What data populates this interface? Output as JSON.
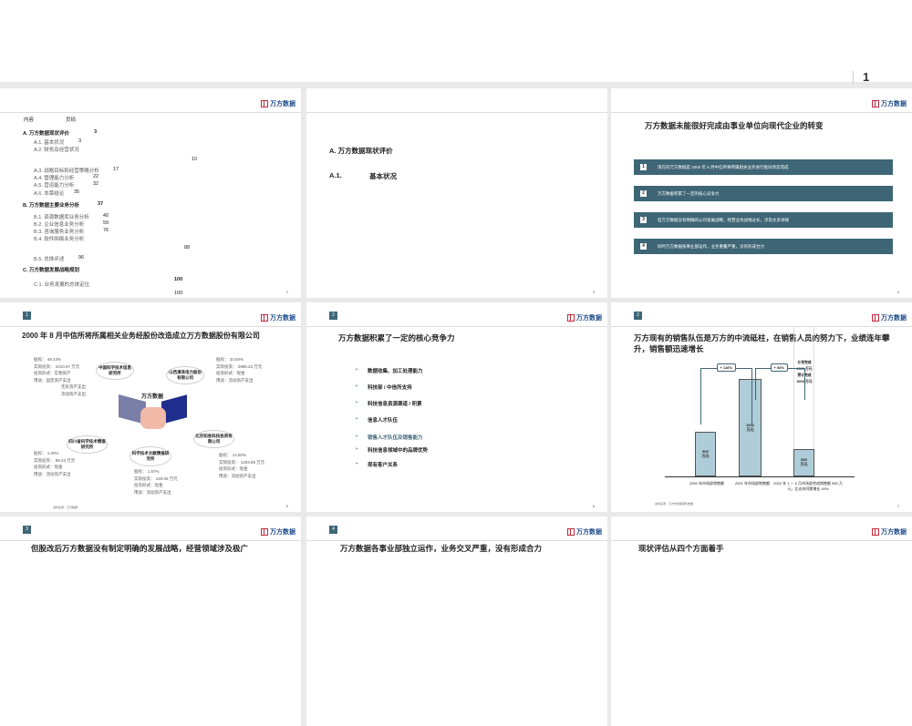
{
  "top_page": {
    "page_number": "1"
  },
  "brand": {
    "logo_text": "万方数据",
    "color": "#c0283a",
    "bar_color": "#3e6676"
  },
  "slides": [
    {
      "page": "2",
      "toc": {
        "header_content": "内容",
        "header_page": "页码",
        "items": [
          {
            "label": "A.  万方数据现状评价",
            "page": "3",
            "level": 1
          },
          {
            "label": "A.1.  基本状况",
            "page": "3",
            "level": 2
          },
          {
            "label": "A.2.  财务及经营状况",
            "page": "10",
            "level": 2
          },
          {
            "label": "A.3.  战略目标和经营策略分析",
            "page": "17",
            "level": 2
          },
          {
            "label": "A.4.  管理能力分析",
            "page": "22",
            "level": 2
          },
          {
            "label": "A.5.  营运能力分析",
            "page": "32",
            "level": 2
          },
          {
            "label": "A.6.  本章结论",
            "page": "35",
            "level": 2
          },
          {
            "label": "B.  万方数据主要业务分析",
            "page": "37",
            "level": 1
          },
          {
            "label": "B.1.  资源数据库业务分析",
            "page": "40",
            "level": 2
          },
          {
            "label": "B.2.  企业信息业务分析",
            "page": "59",
            "level": 2
          },
          {
            "label": "B.3.  咨询服务业务分析",
            "page": "76",
            "level": 2
          },
          {
            "label": "B.4.  软件网络业务分析",
            "page": "88",
            "level": 2
          },
          {
            "label": "B.5.  总体评述",
            "page": "96",
            "level": 2
          },
          {
            "label": "C.  万方数据发展战略规划",
            "page": "100",
            "level": 1
          },
          {
            "label": "C.1.  业务发展的总体定位",
            "page": "100",
            "level": 2
          }
        ]
      }
    },
    {
      "page": "3",
      "section": "A.  万方数据现状评价",
      "subsection_num": "A.1.",
      "subsection": "基本状况"
    },
    {
      "page": "4",
      "title": "万方数据未能很好完成由事业单位向现代企业的转变",
      "bars": [
        {
          "n": "1",
          "text": "现在的万方数据是  2000  年  8  月中信所将所属相关业务进行股份改造而成"
        },
        {
          "n": "2",
          "text": "万方数据积累了一定的核心竞争力"
        },
        {
          "n": "3",
          "text": "但万方数据没有明确的公司发展战略，经营业务战线过长，涉及太多领域"
        },
        {
          "n": "4",
          "text": "同时万方数据按事业部运作，业务重叠严重，没有形成合力"
        }
      ]
    },
    {
      "page": "5",
      "badge": "1",
      "title": "2000  年  8  月中信所将所属相关业务经股份改造成立万方数据股份有限公司",
      "center": "万方数据",
      "source": "资料来源：万方数据",
      "shareholders": [
        {
          "name": "中国科学技术信息研究所",
          "lines": [
            "股权：  49.43%",
            "实际投资：  4410.97  万元",
            "投资形式：实物资产",
            "用途：固定资产支出",
            "无形资产支出",
            "流动资产支出"
          ]
        },
        {
          "name": "山西漳泽电力股份有限公司",
          "lines": [
            "股权：  33.50%",
            "实际投资：  2989.23  万元",
            "投资形式：现金",
            "用途：流动资产支出"
          ]
        },
        {
          "name": "四川省科学技术情报研究所",
          "lines": [
            "股权：  1.00%",
            "实际投资：  89.23  万元",
            "投资形式：现金",
            "用途：流动资产支出"
          ]
        },
        {
          "name": "科学技术文献情报研究所",
          "lines": [
            "股权：  1.57%",
            "实际投资：  140.09  万元",
            "投资形式：现金",
            "用途：流动资产支出"
          ]
        },
        {
          "name": "北京知金科技投资有限公司",
          "lines": [
            "股权：  14.50%",
            "实际投资：  1293.85  万元",
            "投资形式：现金",
            "用途：流动资产支出"
          ]
        }
      ]
    },
    {
      "page": "6",
      "badge": "2",
      "title": "万方数据积累了一定的核心竞争力",
      "bullets": [
        "数据收集、加工处理能力",
        "科技部 / 中信所支持",
        "科技信息资源渠道 / 积累",
        "信息人才队伍",
        "销售人才队伍及销售能力",
        "科技信息领域中的品牌优势",
        "现有客户关系"
      ],
      "highlight_index": 4
    },
    {
      "page": "7",
      "badge": "2",
      "title": "万方现有的销售队伍是万方的中流砥柱，在销售人员的努力下，业绩连年攀升，销售额迅速增长",
      "source": "资料来源：万方市场部销售数据",
      "chart_data": {
        "type": "bar",
        "categories": [
          "2000  年市场部销售额",
          "2001  年市场部销售额",
          "2002  年  1  －  6  月市场部完成销售额  550  万元，比去年同期增长  40%"
        ],
        "values": [
          900,
          1942,
          550
        ],
        "labels": [
          "900 万元",
          "1942 万元",
          "550 万元"
        ],
        "unit": "万元",
        "growth": [
          "+ 116%",
          "+ 54%"
        ],
        "plan_note": [
          "计划完成",
          "2300  万元",
          "预计完成",
          "3000  万元"
        ],
        "plan_value": 3000
      }
    },
    {
      "page": "8",
      "badge": "3",
      "title": "但股改后万方数据没有制定明确的发展战略，经营领域涉及极广"
    },
    {
      "page": "9",
      "badge": "4",
      "title": "万方数据各事业部独立运作，业务交叉严重，没有形成合力"
    },
    {
      "page": "10",
      "title": "现状评估从四个方面着手"
    }
  ]
}
